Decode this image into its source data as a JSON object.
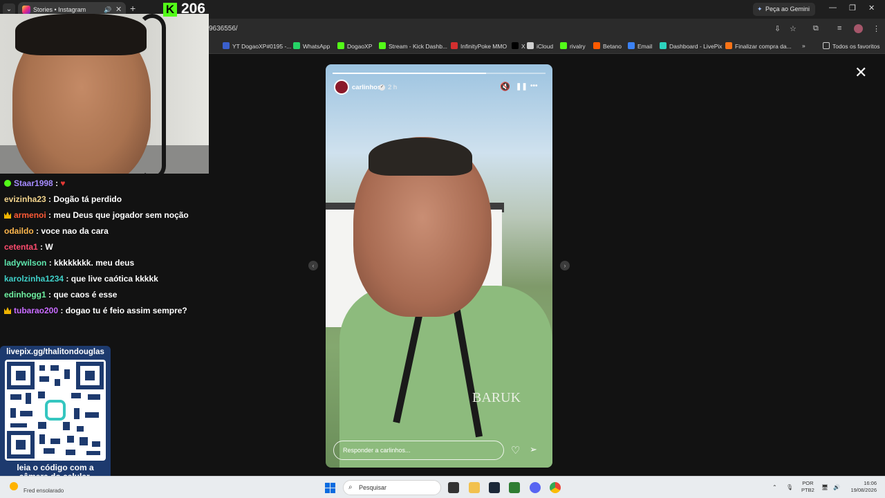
{
  "browser": {
    "tab_title": "Stories • Instagram",
    "tab_close": "✕",
    "tab_audio": "🔊",
    "new_tab": "+",
    "gemini_label": "Peça ao Gemini",
    "url_fragment": "9636556/",
    "window_minimize": "—",
    "window_restore": "❐",
    "window_close": "✕"
  },
  "kick_overlay": {
    "logo": "K",
    "count": "206"
  },
  "bookmarks": [
    {
      "label": "YT DogaoXP#0195 -...",
      "color": "#3a5fcc"
    },
    {
      "label": "WhatsApp",
      "color": "#25d366"
    },
    {
      "label": "DogaoXP",
      "color": "#53fc18"
    },
    {
      "label": "Stream - Kick Dashb...",
      "color": "#53fc18"
    },
    {
      "label": "InfinityPoke MMO",
      "color": "#d32f2f"
    },
    {
      "label": "X",
      "color": "#000000"
    },
    {
      "label": "iCloud",
      "color": "#cfcfcf"
    },
    {
      "label": "rivalry",
      "color": "#53fc18"
    },
    {
      "label": "Betano",
      "color": "#ff5a00"
    },
    {
      "label": "Email",
      "color": "#3b82f6"
    },
    {
      "label": "Dashboard - LivePix",
      "color": "#2dd4bf"
    },
    {
      "label": "Finalizar compra da...",
      "color": "#f97316"
    }
  ],
  "bookmarks_more": "»",
  "bookmarks_all": "Todos os favoritos",
  "chat": [
    {
      "user": "Staar1998",
      "color": "#a58bff",
      "text": "♥",
      "badge": "green",
      "text_color": "#e53935"
    },
    {
      "user": "evizinha23",
      "color": "#f4d58d",
      "text": "Dogão tá perdido",
      "badge": "",
      "text_color": "#ffffff"
    },
    {
      "user": "armenoi",
      "color": "#ff5a36",
      "text": "meu Deus que jogador sem noção",
      "badge": "crown",
      "text_color": "#ffffff"
    },
    {
      "user": "odaildo",
      "color": "#ffb74d",
      "text": "voce nao da cara",
      "badge": "",
      "text_color": "#ffffff"
    },
    {
      "user": "cetenta1",
      "color": "#ff4b6e",
      "text": "W",
      "badge": "",
      "text_color": "#ffffff"
    },
    {
      "user": "ladywilson",
      "color": "#5ee6ad",
      "text": "kkkkkkkk. meu deus",
      "badge": "",
      "text_color": "#ffffff"
    },
    {
      "user": "karolzinha1234",
      "color": "#3fd0c9",
      "text": "que live caótica kkkkk",
      "badge": "",
      "text_color": "#ffffff"
    },
    {
      "user": "edinhogg1",
      "color": "#6ef0a0",
      "text": "que caos é esse",
      "badge": "",
      "text_color": "#ffffff"
    },
    {
      "user": "tubarao200",
      "color": "#c86bff",
      "text": "dogao tu é feio assim sempre?",
      "badge": "crown",
      "text_color": "#ffffff"
    }
  ],
  "chat_separator": ":",
  "qr": {
    "title": "livepix.gg/thalitondouglas",
    "caption_line1": "leia o código com a",
    "caption_line2": "câmera do celular."
  },
  "story": {
    "username": "carlinhos",
    "verified": "✓",
    "time": "2 h",
    "progress": 0.72,
    "mute_icon": "🔇",
    "pause_icon": "❚❚",
    "more_icon": "•••",
    "reply_placeholder": "Responder a carlinhos...",
    "heart_icon": "♡",
    "send_icon": "➢",
    "brand_line1": "BARUK",
    "prev_arrow": "‹",
    "next_arrow": "›",
    "close": "✕"
  },
  "taskbar": {
    "weather": "Fred ensolarado",
    "search_placeholder": "Pesquisar",
    "search_icon": "⌕",
    "lang_line1": "POR",
    "lang_line2": "PTB2",
    "time": "16:06",
    "date": "19/08/2026",
    "tray_up": "⌃",
    "tray_mic": "🎙",
    "tray_net": "🖥",
    "tray_vol": "🔊"
  }
}
